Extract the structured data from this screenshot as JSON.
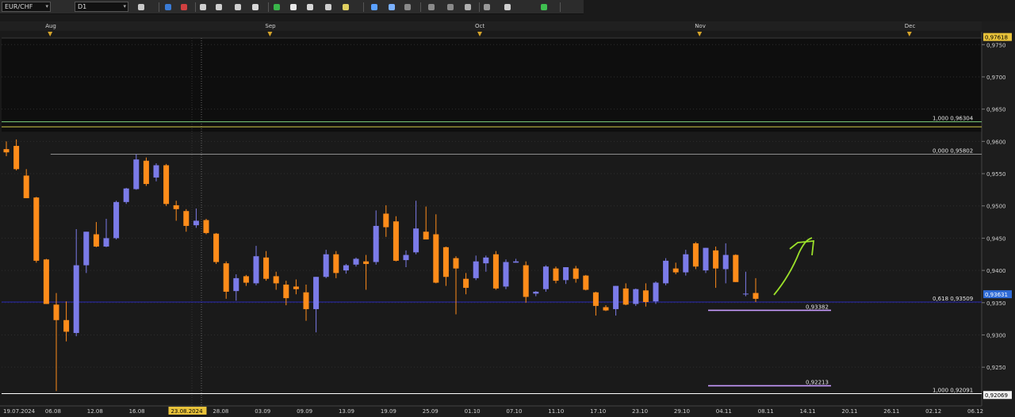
{
  "toolbar": {
    "symbol": "EUR/CHF",
    "timeframe": "D1",
    "buttons": [
      {
        "name": "chart-type-button",
        "color": "#c9c9c9"
      },
      {
        "name": "bar-chart-button",
        "color": "#3a7bd5"
      },
      {
        "name": "line-chart-button",
        "color": "#d04040"
      },
      {
        "name": "zoom-in-button",
        "color": "#cfcfcf"
      },
      {
        "name": "zoom-out-button",
        "color": "#cfcfcf"
      },
      {
        "name": "autoscroll-button",
        "color": "#cfcfcf"
      },
      {
        "name": "crosshair-button",
        "color": "#d8d8d8"
      },
      {
        "name": "hline-tool-button",
        "color": "#39b54a"
      },
      {
        "name": "text-tool-button",
        "color": "#e8e8e8"
      },
      {
        "name": "palette-button",
        "color": "#d8d8d8"
      },
      {
        "name": "objects-button",
        "color": "#cfcfcf"
      },
      {
        "name": "pen-tool-button",
        "color": "#e0d060"
      },
      {
        "name": "indicators-button",
        "color": "#5aa0ff"
      },
      {
        "name": "fibonacci-tool-button",
        "color": "#7ab0ff"
      },
      {
        "name": "trendline-tool-button",
        "color": "#8a8a8a"
      },
      {
        "name": "channel-tool-button",
        "color": "#8a8a8a"
      },
      {
        "name": "ellipse-tool-button",
        "color": "#8a8a8a"
      },
      {
        "name": "circle-tool-button",
        "color": "#b0b0b0"
      },
      {
        "name": "shape-tool-button",
        "color": "#9a9a9a"
      },
      {
        "name": "eraser-button",
        "color": "#d0d0d0"
      },
      {
        "name": "settings-button",
        "color": "#3fbf50"
      }
    ]
  },
  "chart_data": {
    "type": "candlestick",
    "symbol": "EUR/CHF",
    "timeframe": "D1",
    "ylim": [
      0.919,
      0.977
    ],
    "y_ticks": [
      "0,9750",
      "0,9700",
      "0,9650",
      "0,9600",
      "0,9550",
      "0,9500",
      "0,9450",
      "0,9400",
      "0,9350",
      "0,9300",
      "0,9250"
    ],
    "price_badges": [
      {
        "label": "0,97618",
        "value": 0.97618,
        "bg": "#e8c23a",
        "fg": "#000000"
      },
      {
        "label": "0,93631",
        "value": 0.93631,
        "bg": "#2f6bd6",
        "fg": "#ffffff"
      },
      {
        "label": "0,92069",
        "value": 0.92069,
        "bg": "#f2f2f2",
        "fg": "#000000"
      }
    ],
    "x_labels": [
      "19.07.2024",
      "06.08",
      "12.08",
      "16.08",
      "23.08.2024",
      "28.08",
      "03.09",
      "09.09",
      "13.09",
      "19.09",
      "25.09",
      "01.10",
      "07.10",
      "11.10",
      "17.10",
      "23.10",
      "29.10",
      "04.11",
      "08.11",
      "14.11",
      "20.11",
      "26.11",
      "02.12",
      "06.12"
    ],
    "highlighted_x_label": "23.08.2024",
    "month_labels": [
      "Aug",
      "Sep",
      "Oct",
      "Nov",
      "Dec"
    ],
    "candles": [
      {
        "o": 0.9588,
        "h": 0.96,
        "l": 0.9577,
        "c": 0.9583
      },
      {
        "o": 0.9593,
        "h": 0.9603,
        "l": 0.9555,
        "c": 0.9557
      },
      {
        "o": 0.9547,
        "h": 0.9557,
        "l": 0.9512,
        "c": 0.9512
      },
      {
        "o": 0.9513,
        "h": 0.9514,
        "l": 0.9412,
        "c": 0.9415
      },
      {
        "o": 0.9417,
        "h": 0.9418,
        "l": 0.9348,
        "c": 0.9348
      },
      {
        "o": 0.9347,
        "h": 0.9365,
        "l": 0.9213,
        "c": 0.9323
      },
      {
        "o": 0.9323,
        "h": 0.9352,
        "l": 0.929,
        "c": 0.9305
      },
      {
        "o": 0.9303,
        "h": 0.9464,
        "l": 0.9298,
        "c": 0.9408
      },
      {
        "o": 0.9408,
        "h": 0.946,
        "l": 0.9396,
        "c": 0.946
      },
      {
        "o": 0.9456,
        "h": 0.9475,
        "l": 0.9436,
        "c": 0.9437
      },
      {
        "o": 0.9437,
        "h": 0.948,
        "l": 0.9436,
        "c": 0.945
      },
      {
        "o": 0.945,
        "h": 0.9508,
        "l": 0.9448,
        "c": 0.9506
      },
      {
        "o": 0.9506,
        "h": 0.9528,
        "l": 0.9503,
        "c": 0.9527
      },
      {
        "o": 0.9526,
        "h": 0.958,
        "l": 0.9525,
        "c": 0.9572
      },
      {
        "o": 0.957,
        "h": 0.9575,
        "l": 0.9531,
        "c": 0.9534
      },
      {
        "o": 0.9544,
        "h": 0.9566,
        "l": 0.9538,
        "c": 0.9563
      },
      {
        "o": 0.9563,
        "h": 0.9565,
        "l": 0.95,
        "c": 0.9503
      },
      {
        "o": 0.9501,
        "h": 0.9508,
        "l": 0.9477,
        "c": 0.9495
      },
      {
        "o": 0.9492,
        "h": 0.9495,
        "l": 0.946,
        "c": 0.9469
      },
      {
        "o": 0.947,
        "h": 0.9496,
        "l": 0.9466,
        "c": 0.9477
      },
      {
        "o": 0.9478,
        "h": 0.948,
        "l": 0.9456,
        "c": 0.9458
      },
      {
        "o": 0.9457,
        "h": 0.9458,
        "l": 0.941,
        "c": 0.9413
      },
      {
        "o": 0.9411,
        "h": 0.9414,
        "l": 0.9356,
        "c": 0.9367
      },
      {
        "o": 0.9368,
        "h": 0.9394,
        "l": 0.9353,
        "c": 0.9388
      },
      {
        "o": 0.9391,
        "h": 0.9393,
        "l": 0.9376,
        "c": 0.9381
      },
      {
        "o": 0.938,
        "h": 0.9438,
        "l": 0.9377,
        "c": 0.9422
      },
      {
        "o": 0.942,
        "h": 0.943,
        "l": 0.9384,
        "c": 0.9387
      },
      {
        "o": 0.9391,
        "h": 0.9398,
        "l": 0.937,
        "c": 0.938
      },
      {
        "o": 0.9378,
        "h": 0.9384,
        "l": 0.9346,
        "c": 0.9357
      },
      {
        "o": 0.9375,
        "h": 0.9386,
        "l": 0.9363,
        "c": 0.9371
      },
      {
        "o": 0.9366,
        "h": 0.9378,
        "l": 0.9322,
        "c": 0.934
      },
      {
        "o": 0.934,
        "h": 0.939,
        "l": 0.9304,
        "c": 0.939
      },
      {
        "o": 0.939,
        "h": 0.9432,
        "l": 0.9388,
        "c": 0.9425
      },
      {
        "o": 0.9425,
        "h": 0.943,
        "l": 0.9388,
        "c": 0.9396
      },
      {
        "o": 0.94,
        "h": 0.941,
        "l": 0.9395,
        "c": 0.9408
      },
      {
        "o": 0.9409,
        "h": 0.942,
        "l": 0.9406,
        "c": 0.9418
      },
      {
        "o": 0.9414,
        "h": 0.9424,
        "l": 0.937,
        "c": 0.941
      },
      {
        "o": 0.9413,
        "h": 0.9493,
        "l": 0.9409,
        "c": 0.9469
      },
      {
        "o": 0.9488,
        "h": 0.9501,
        "l": 0.9452,
        "c": 0.9467
      },
      {
        "o": 0.9476,
        "h": 0.9484,
        "l": 0.9414,
        "c": 0.9415
      },
      {
        "o": 0.9416,
        "h": 0.9431,
        "l": 0.9405,
        "c": 0.9424
      },
      {
        "o": 0.9428,
        "h": 0.9508,
        "l": 0.9425,
        "c": 0.9465
      },
      {
        "o": 0.946,
        "h": 0.9499,
        "l": 0.9448,
        "c": 0.9448
      },
      {
        "o": 0.9456,
        "h": 0.9487,
        "l": 0.938,
        "c": 0.9381
      },
      {
        "o": 0.9436,
        "h": 0.9437,
        "l": 0.9376,
        "c": 0.939
      },
      {
        "o": 0.9419,
        "h": 0.9422,
        "l": 0.9332,
        "c": 0.9403
      },
      {
        "o": 0.9387,
        "h": 0.9396,
        "l": 0.9363,
        "c": 0.9373
      },
      {
        "o": 0.9388,
        "h": 0.9423,
        "l": 0.9385,
        "c": 0.9414
      },
      {
        "o": 0.9411,
        "h": 0.9423,
        "l": 0.9398,
        "c": 0.942
      },
      {
        "o": 0.9425,
        "h": 0.943,
        "l": 0.937,
        "c": 0.9372
      },
      {
        "o": 0.9375,
        "h": 0.9417,
        "l": 0.9371,
        "c": 0.9413
      },
      {
        "o": 0.9412,
        "h": 0.9418,
        "l": 0.9412,
        "c": 0.9414
      },
      {
        "o": 0.9408,
        "h": 0.9414,
        "l": 0.935,
        "c": 0.9359
      },
      {
        "o": 0.9364,
        "h": 0.9368,
        "l": 0.936,
        "c": 0.9367
      },
      {
        "o": 0.9371,
        "h": 0.9408,
        "l": 0.9367,
        "c": 0.9406
      },
      {
        "o": 0.9403,
        "h": 0.9406,
        "l": 0.938,
        "c": 0.9384
      },
      {
        "o": 0.9385,
        "h": 0.9405,
        "l": 0.9379,
        "c": 0.9405
      },
      {
        "o": 0.9403,
        "h": 0.9407,
        "l": 0.9381,
        "c": 0.9387
      },
      {
        "o": 0.9392,
        "h": 0.9393,
        "l": 0.9369,
        "c": 0.937
      },
      {
        "o": 0.9366,
        "h": 0.9367,
        "l": 0.933,
        "c": 0.9345
      },
      {
        "o": 0.9343,
        "h": 0.9346,
        "l": 0.9337,
        "c": 0.9338
      },
      {
        "o": 0.934,
        "h": 0.9376,
        "l": 0.933,
        "c": 0.9376
      },
      {
        "o": 0.9372,
        "h": 0.938,
        "l": 0.9346,
        "c": 0.9347
      },
      {
        "o": 0.9348,
        "h": 0.9372,
        "l": 0.9345,
        "c": 0.9371
      },
      {
        "o": 0.9369,
        "h": 0.938,
        "l": 0.9344,
        "c": 0.9351
      },
      {
        "o": 0.9352,
        "h": 0.9383,
        "l": 0.9348,
        "c": 0.9381
      },
      {
        "o": 0.938,
        "h": 0.9419,
        "l": 0.9377,
        "c": 0.9415
      },
      {
        "o": 0.9403,
        "h": 0.9412,
        "l": 0.9394,
        "c": 0.9397
      },
      {
        "o": 0.9397,
        "h": 0.9432,
        "l": 0.9392,
        "c": 0.9425
      },
      {
        "o": 0.9442,
        "h": 0.9444,
        "l": 0.9402,
        "c": 0.9406
      },
      {
        "o": 0.94,
        "h": 0.9435,
        "l": 0.9396,
        "c": 0.9435
      },
      {
        "o": 0.9431,
        "h": 0.9437,
        "l": 0.9373,
        "c": 0.9403
      },
      {
        "o": 0.9402,
        "h": 0.9442,
        "l": 0.938,
        "c": 0.9424
      },
      {
        "o": 0.9424,
        "h": 0.9425,
        "l": 0.9382,
        "c": 0.9382
      },
      {
        "o": 0.9363,
        "h": 0.9398,
        "l": 0.936,
        "c": 0.9364
      },
      {
        "o": 0.9365,
        "h": 0.9388,
        "l": 0.9351,
        "c": 0.9356
      }
    ],
    "horizontal_lines": [
      {
        "label": "1,000 0,96304",
        "value": 0.96304,
        "color": "#7fd07f",
        "x_start": 0
      },
      {
        "label": "",
        "value": 0.96225,
        "color": "#d6cf4a",
        "x_start": 0
      },
      {
        "label": "0,000 0,95802",
        "value": 0.95802,
        "color": "#8d8d8d",
        "x_start": 0.05
      },
      {
        "label": "0,618 0,93509",
        "value": 0.93509,
        "color": "#2a2ab8",
        "x_start": 0
      },
      {
        "label": "1,000 0,92091",
        "value": 0.92091,
        "color": "#ffffff",
        "x_start": 0
      }
    ],
    "level_segments": [
      {
        "label": "0,93382",
        "value": 0.93382,
        "color": "#c89cff"
      },
      {
        "label": "0,92213",
        "value": 0.92213,
        "color": "#c89cff"
      }
    ],
    "colors": {
      "bull": "#7b7be8",
      "bear": "#ff8c1a",
      "background": "#1a1a1a",
      "upper_zone": "#0e0e0e",
      "grid": "#2e2e2e",
      "arrow": "#9be02a"
    }
  }
}
